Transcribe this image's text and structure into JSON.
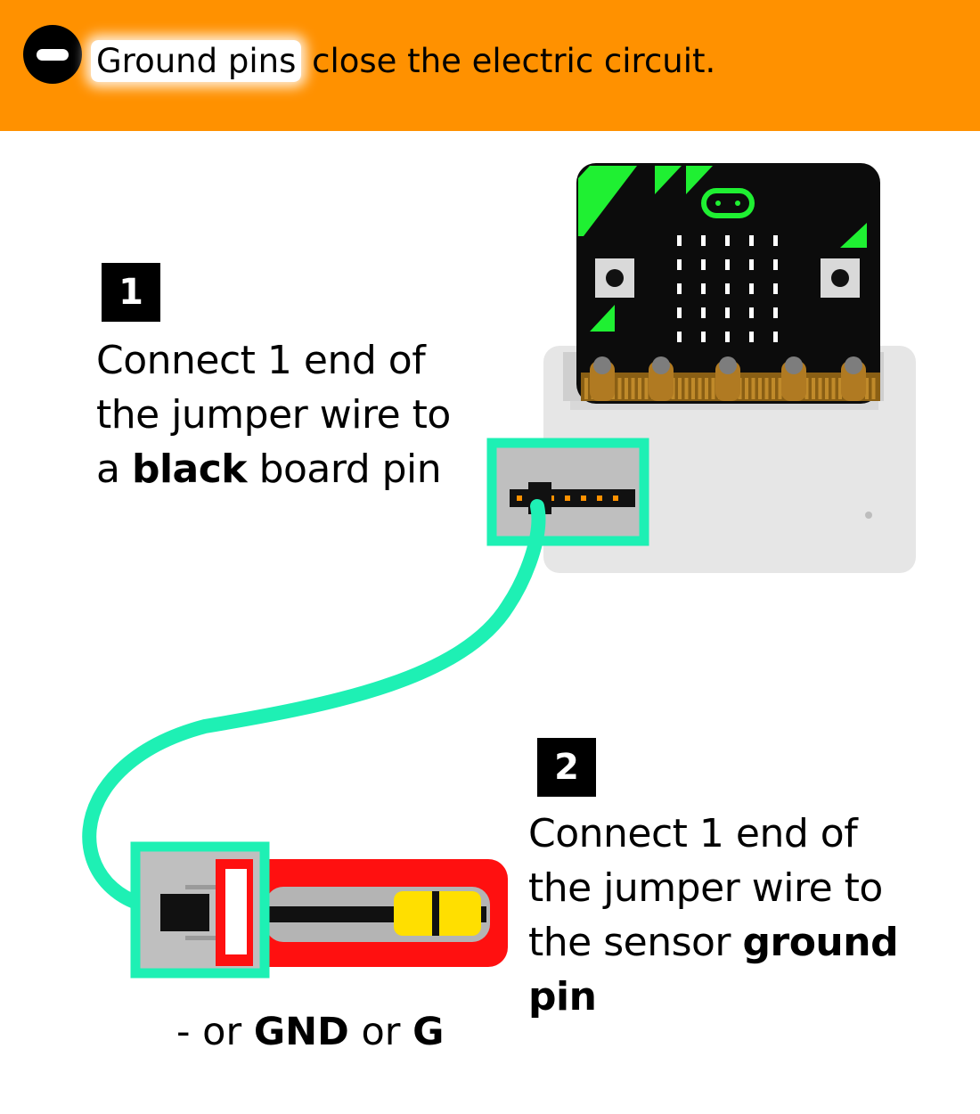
{
  "banner": {
    "highlight": "Ground pins",
    "rest": " close the electric circuit.",
    "icon": "minus-circle-icon"
  },
  "step1": {
    "number": "1",
    "line1": "Connect 1 end of",
    "line2": "the jumper wire to",
    "line3_pre": "a ",
    "line3_bold": "black",
    "line3_post": " board pin"
  },
  "step2": {
    "number": "2",
    "line1": "Connect 1 end of",
    "line2": "the jumper wire to",
    "line3_pre": "the sensor ",
    "line3_bold": "ground",
    "line4_bold": "pin"
  },
  "pin_caption": {
    "pre": "- or ",
    "gnd": "GND",
    "mid": " or ",
    "g": "G"
  },
  "colors": {
    "banner": "#ff9100",
    "wire": "#1ef0b4",
    "board_green": "#1ff032",
    "sensor_red": "#ff1010",
    "resistor_yellow": "#ffdf00"
  }
}
